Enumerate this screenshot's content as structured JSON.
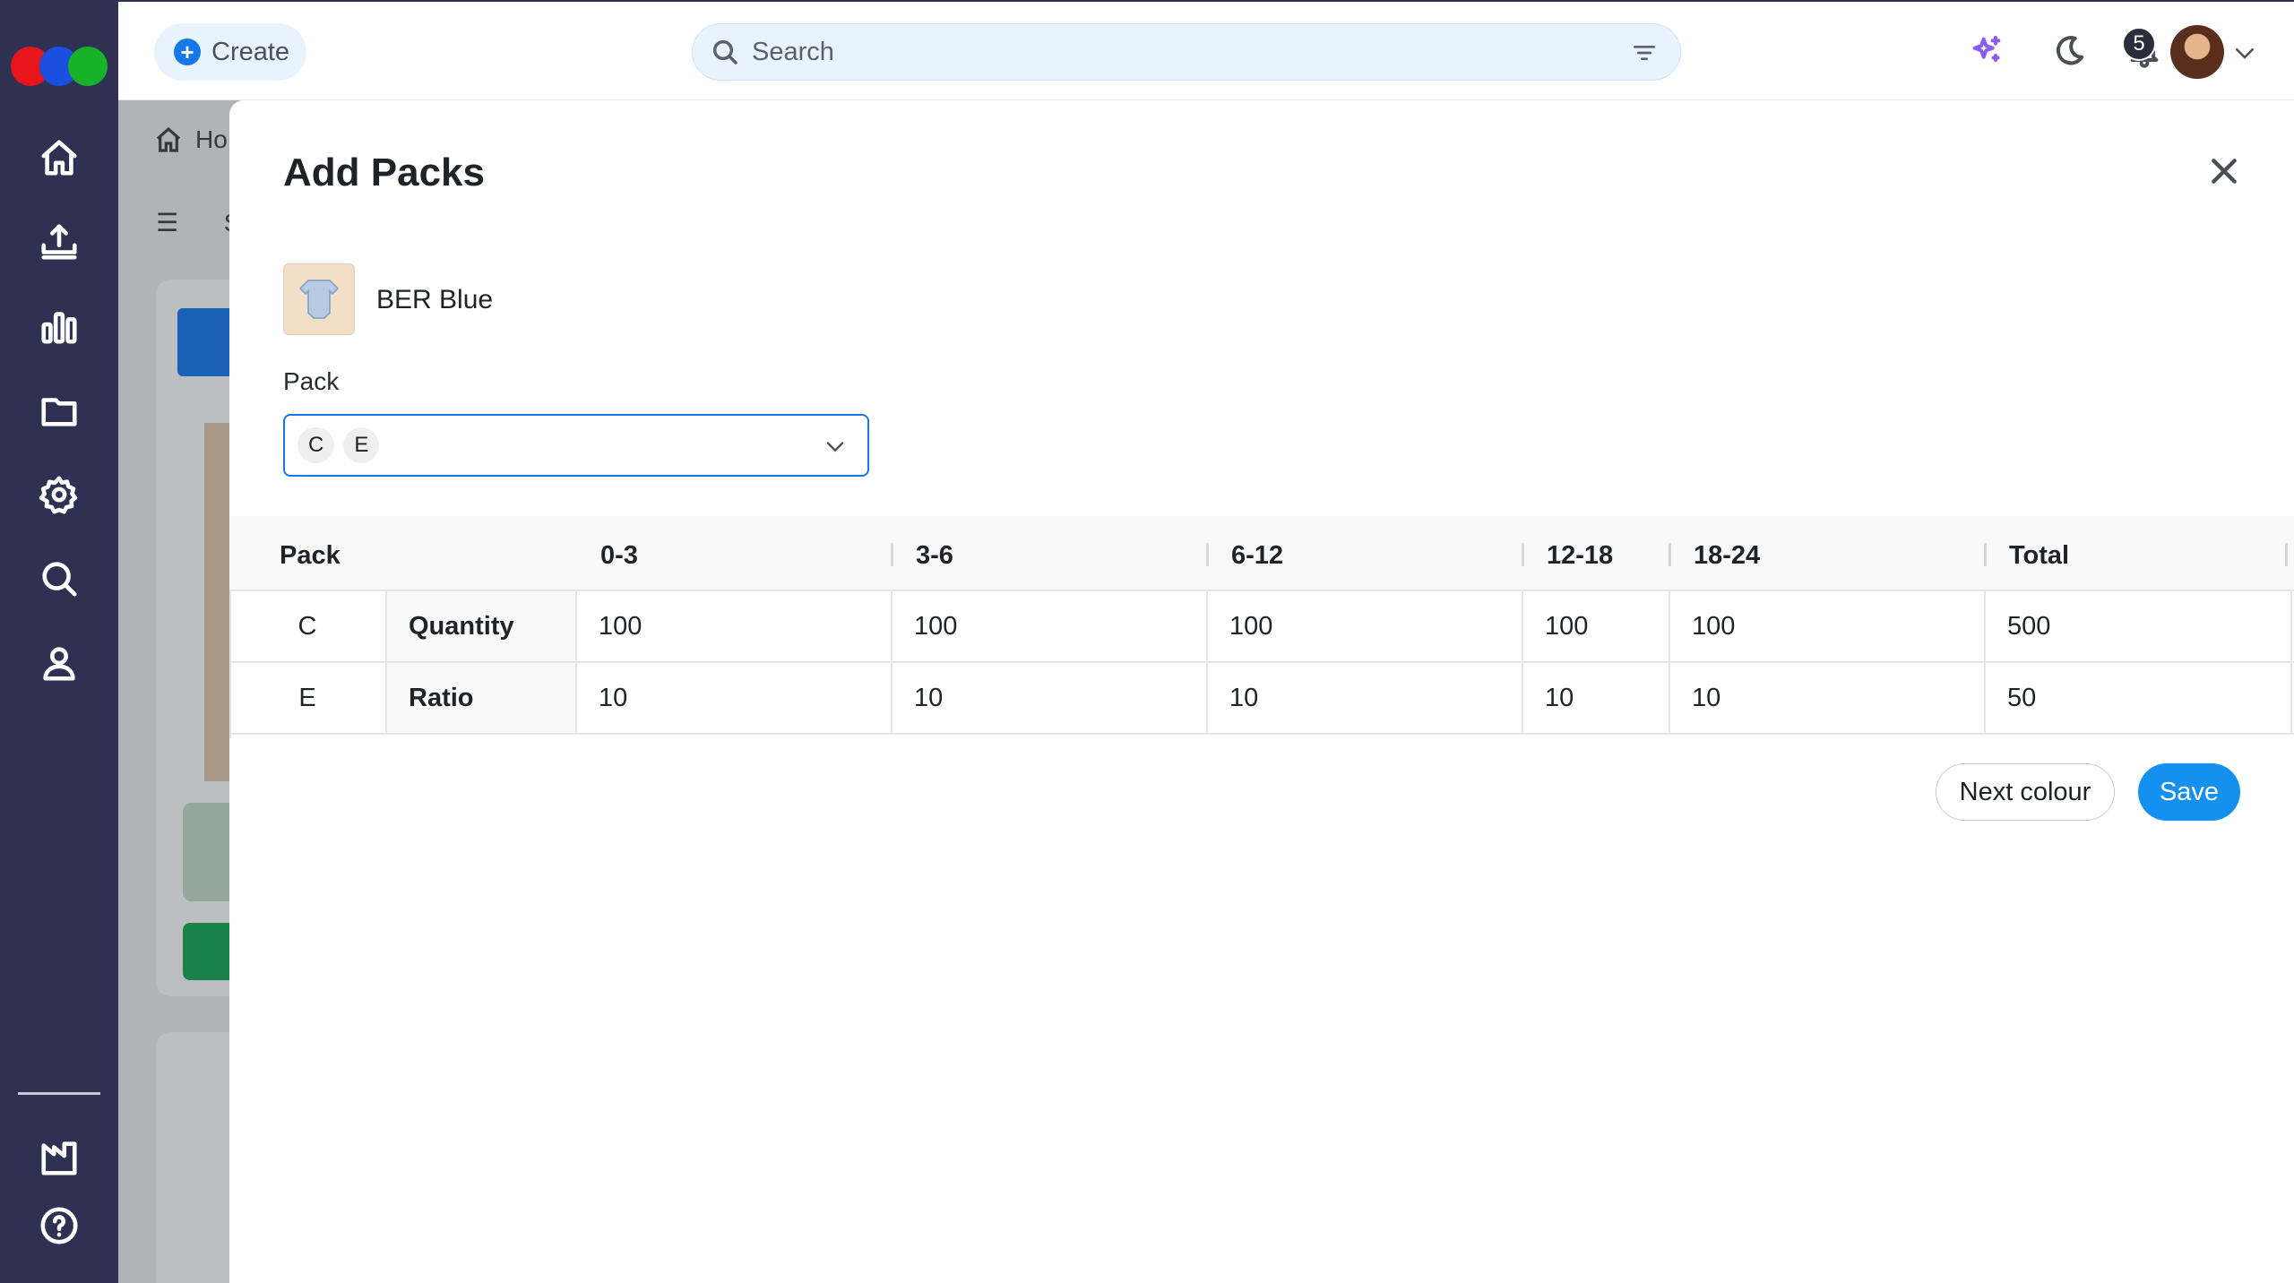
{
  "brand": {
    "logo_colors": [
      "#e8141c",
      "#1b4fe0",
      "#18b22a"
    ]
  },
  "sidebar": {
    "items": [
      {
        "icon": "home-icon"
      },
      {
        "icon": "upload-icon"
      },
      {
        "icon": "bar-chart-icon"
      },
      {
        "icon": "folder-icon"
      },
      {
        "icon": "gear-icon"
      },
      {
        "icon": "search-icon"
      },
      {
        "icon": "user-icon"
      }
    ],
    "bottom_items": [
      {
        "icon": "factory-icon"
      },
      {
        "icon": "help-icon"
      }
    ]
  },
  "topbar": {
    "create_label": "Create",
    "search_placeholder": "Search",
    "notification_count": "5",
    "accent_color": "#1677e8"
  },
  "background": {
    "breadcrumb": "Ho",
    "menu_letter": "S"
  },
  "modal": {
    "title": "Add Packs",
    "product": {
      "name": "BER Blue"
    },
    "pack_field": {
      "label": "Pack",
      "selected": [
        "C",
        "E"
      ]
    },
    "table": {
      "columns": [
        "Pack",
        "0-3",
        "3-6",
        "6-12",
        "12-18",
        "18-24",
        "Total"
      ],
      "rows": [
        {
          "pack": "C",
          "type": "Quantity",
          "values": [
            "100",
            "100",
            "100",
            "100",
            "100",
            "500"
          ]
        },
        {
          "pack": "E",
          "type": "Ratio",
          "values": [
            "10",
            "10",
            "10",
            "10",
            "10",
            "50"
          ]
        }
      ]
    },
    "buttons": {
      "next_colour": "Next colour",
      "save": "Save"
    }
  }
}
